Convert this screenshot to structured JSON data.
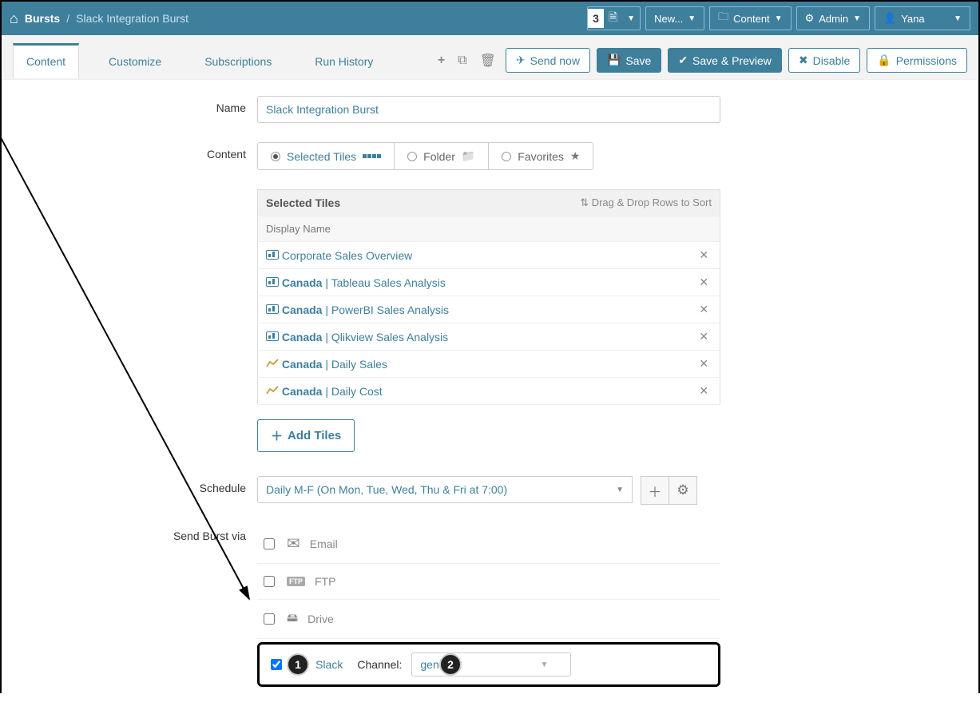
{
  "header": {
    "breadcrumb_root": "Bursts",
    "breadcrumb_current": "Slack Integration Burst",
    "notif_count": "3",
    "new_label": "New...",
    "content_label": "Content",
    "admin_label": "Admin",
    "user_name": "Yana"
  },
  "tabs": {
    "content": "Content",
    "customize": "Customize",
    "subscriptions": "Subscriptions",
    "run_history": "Run History"
  },
  "actions": {
    "send_now": "Send now",
    "save": "Save",
    "save_preview": "Save & Preview",
    "disable": "Disable",
    "permissions": "Permissions"
  },
  "form": {
    "name_label": "Name",
    "name_value": "Slack Integration Burst",
    "content_label": "Content",
    "segments": {
      "selected_tiles": "Selected Tiles",
      "folder": "Folder",
      "favorites": "Favorites"
    },
    "tiles_header": "Selected Tiles",
    "sort_hint": "Drag & Drop Rows to Sort",
    "display_name_col": "Display Name",
    "tiles": [
      {
        "icon": "chart",
        "bold": "",
        "text": "Corporate Sales Overview"
      },
      {
        "icon": "chart",
        "bold": "Canada",
        "text": " | Tableau Sales Analysis"
      },
      {
        "icon": "chart",
        "bold": "Canada",
        "text": " | PowerBI Sales Analysis"
      },
      {
        "icon": "chart",
        "bold": "Canada",
        "text": " | Qlikview Sales Analysis"
      },
      {
        "icon": "line",
        "bold": "Canada",
        "text": " | Daily Sales"
      },
      {
        "icon": "line",
        "bold": "Canada",
        "text": " | Daily Cost"
      }
    ],
    "add_tiles": "Add Tiles",
    "schedule_label": "Schedule",
    "schedule_value": "Daily M-F (On Mon, Tue, Wed, Thu & Fri at 7:00)",
    "send_via_label": "Send Burst via",
    "via": {
      "email": "Email",
      "ftp": "FTP",
      "drive": "Drive",
      "slack": "Slack",
      "channel_label": "Channel:",
      "channel_value": "general"
    }
  },
  "annotations": {
    "one": "1",
    "two": "2"
  }
}
